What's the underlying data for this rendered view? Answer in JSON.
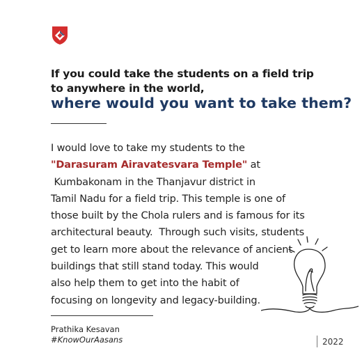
{
  "header": {
    "question_line1": "If you could take the students on a field trip",
    "question_line2": "to anywhere in the world,",
    "question_highlight": "where would you want to take them?"
  },
  "answer": {
    "line1": "I would love to take my students to the",
    "highlight": "\"Darasuram Airavatesvara Temple\"",
    "after_highlight": " at",
    "line3": " Kumbakonam in the Thanjavur district in",
    "line4": "Tamil Nadu for a field trip. This temple is one of",
    "line5": "those built by the Chola rulers and is famous for its",
    "line6": "architectural beauty.  Through such visits, students",
    "line7": "get to learn more about the relevance of ancient",
    "line8": "buildings that still stand today. This would",
    "line9": "also help them to get into the habit of",
    "line10": "focusing on longevity and legacy-building."
  },
  "footer": {
    "author": "Prathika Kesavan",
    "hashtag": "#KnowOurAasans",
    "year": "2022"
  },
  "colors": {
    "accent_red": "#a62b2b",
    "navy": "#1f3a63",
    "logo_red": "#d42e2e"
  },
  "icons": {
    "logo": "shield-logo",
    "illustration": "lightbulb-icon"
  }
}
